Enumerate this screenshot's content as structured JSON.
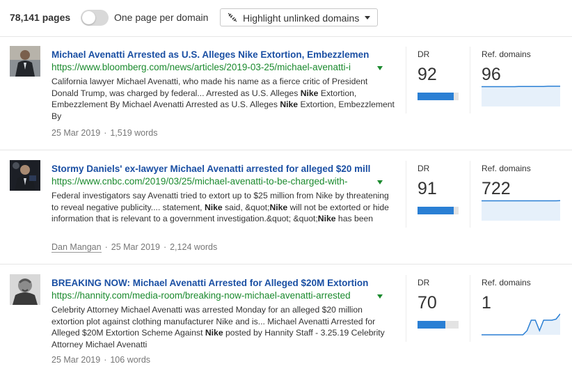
{
  "toolbar": {
    "pages_count": "78,141 pages",
    "toggle_label": "One page per domain",
    "toggle_on": false,
    "highlight_label": "Highlight unlinked domains"
  },
  "labels": {
    "dr": "DR",
    "ref_domains": "Ref. domains"
  },
  "colors": {
    "title": "#1a4fa3",
    "url": "#1b8a2e",
    "bar": "#2a7fd4",
    "spark": "#2a7fd4"
  },
  "results": [
    {
      "title": "Michael Avenatti Arrested as U.S. Alleges Nike Extortion, Embezzlemen",
      "url": "https://www.bloomberg.com/news/articles/2019-03-25/michael-avenatti-i",
      "snippet": [
        {
          "t": "California lawyer Michael Avenatti, who made his name as a fierce critic of President Donald Trump, was charged by federal... Arrested as U.S. Alleges ",
          "b": false
        },
        {
          "t": "Nike",
          "b": true
        },
        {
          "t": " Extortion, Embezzlement By Michael Avenatti Arrested as U.S. Alleges ",
          "b": false
        },
        {
          "t": "Nike",
          "b": true
        },
        {
          "t": " Extortion, Embezzlement By",
          "b": false
        }
      ],
      "author": "",
      "date": "25 Mar 2019",
      "words": "1,519 words",
      "dr": "92",
      "dr_fraction": 0.92,
      "ref_domains": "96",
      "spark": [
        0.95,
        0.95,
        0.95,
        0.95,
        0.95,
        0.95,
        0.95,
        0.95,
        0.95,
        0.96,
        0.96,
        0.96,
        0.96,
        0.96,
        0.96,
        0.96,
        0.97,
        0.97,
        0.97,
        0.97
      ]
    },
    {
      "title": "Stormy Daniels' ex-lawyer Michael Avenatti arrested for alleged $20 mill",
      "url": "https://www.cnbc.com/2019/03/25/michael-avenatti-to-be-charged-with-",
      "snippet": [
        {
          "t": "Federal investigators say Avenatti tried to extort up to $25 million from Nike by threatening to reveal negative publicity.... statement, ",
          "b": false
        },
        {
          "t": "Nike",
          "b": true
        },
        {
          "t": " said, &quot;",
          "b": false
        },
        {
          "t": "Nike",
          "b": true
        },
        {
          "t": " will not be extorted or hide information that is relevant to a government investigation.&quot; &quot;",
          "b": false
        },
        {
          "t": "Nike",
          "b": true
        },
        {
          "t": " has been",
          "b": false
        }
      ],
      "author": "Dan Mangan",
      "date": "25 Mar 2019",
      "words": "2,124 words",
      "dr": "91",
      "dr_fraction": 0.91,
      "ref_domains": "722",
      "spark": [
        0.95,
        0.95,
        0.95,
        0.95,
        0.95,
        0.95,
        0.95,
        0.95,
        0.95,
        0.95,
        0.95,
        0.95,
        0.95,
        0.95,
        0.95,
        0.95,
        0.95,
        0.95,
        0.95,
        0.96
      ]
    },
    {
      "title": "BREAKING NOW: Michael Avenatti Arrested for Alleged $20M Extortion",
      "url": "https://hannity.com/media-room/breaking-now-michael-avenatti-arrested",
      "snippet": [
        {
          "t": "Celebrity Attorney Michael Avenatti was arrested Monday for an alleged $20 million extortion plot against clothing manufacturer Nike and is... Michael Avenatti Arrested for Alleged $20M Extortion Scheme Against ",
          "b": false
        },
        {
          "t": "Nike",
          "b": true
        },
        {
          "t": " posted by Hannity Staff - 3.25.19 Celebrity Attorney Michael Avenatti",
          "b": false
        }
      ],
      "author": "",
      "date": "25 Mar 2019",
      "words": "106 words",
      "dr": "70",
      "dr_fraction": 0.7,
      "ref_domains": "1",
      "spark": [
        0,
        0,
        0,
        0,
        0,
        0,
        0,
        0,
        0,
        0,
        0,
        0.2,
        0.7,
        0.7,
        0.2,
        0.7,
        0.7,
        0.7,
        0.75,
        1
      ]
    }
  ]
}
